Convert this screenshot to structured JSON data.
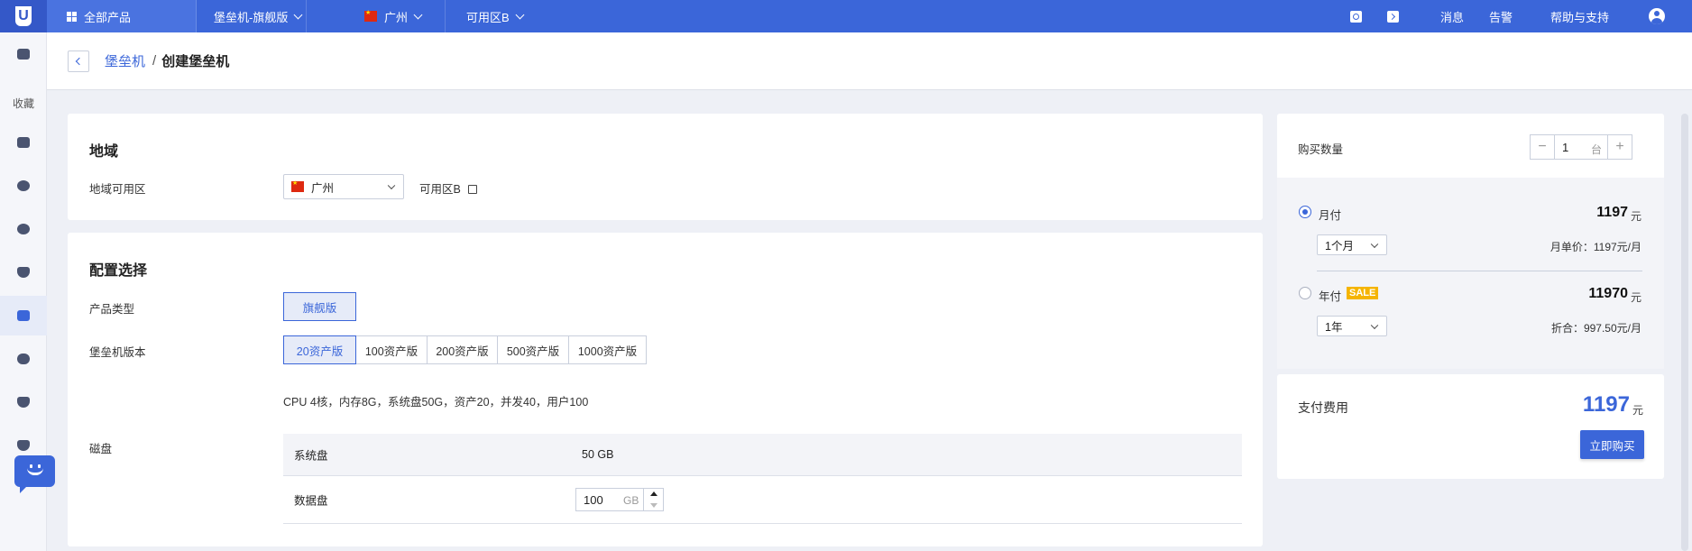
{
  "topbar": {
    "logo": "U",
    "all_products": "全部产品",
    "product": "堡垒机-旗舰版",
    "region": "广州",
    "zone": "可用区B",
    "messages": "消息",
    "alerts": "告警",
    "help": "帮助与支持"
  },
  "sidebar": {
    "favorites": "收藏"
  },
  "breadcrumb": {
    "parent": "堡垒机",
    "separator": "/",
    "current": "创建堡垒机"
  },
  "region_card": {
    "title": "地域",
    "label": "地域可用区",
    "region_value": "广州",
    "zone_value": "可用区B"
  },
  "config_card": {
    "title": "配置选择",
    "product_type_label": "产品类型",
    "product_type_option": "旗舰版",
    "version_label": "堡垒机版本",
    "versions": [
      "20资产版",
      "100资产版",
      "200资产版",
      "500资产版",
      "1000资产版"
    ],
    "selected_version": "20资产版",
    "spec": "CPU 4核，内存8G，系统盘50G，资产20，并发40，用户100",
    "disk_label": "磁盘",
    "system_disk_label": "系统盘",
    "system_disk_value": "50 GB",
    "data_disk_label": "数据盘",
    "data_disk_value": "100",
    "data_disk_unit": "GB"
  },
  "order": {
    "qty_label": "购买数量",
    "qty_value": "1",
    "qty_unit": "台",
    "monthly": {
      "label": "月付",
      "price": "1197",
      "unit": "元",
      "period": "1个月",
      "note": "月单价：1197元/月",
      "selected": true
    },
    "yearly": {
      "label": "年付",
      "badge": "SALE",
      "price": "11970",
      "unit": "元",
      "period": "1年",
      "note": "折合：997.50元/月",
      "selected": false
    },
    "total_label": "支付费用",
    "total_price": "1197",
    "total_unit": "元",
    "buy_button": "立即购买"
  },
  "colors": {
    "brand": "#3b66d9",
    "sale": "#f5b400"
  }
}
